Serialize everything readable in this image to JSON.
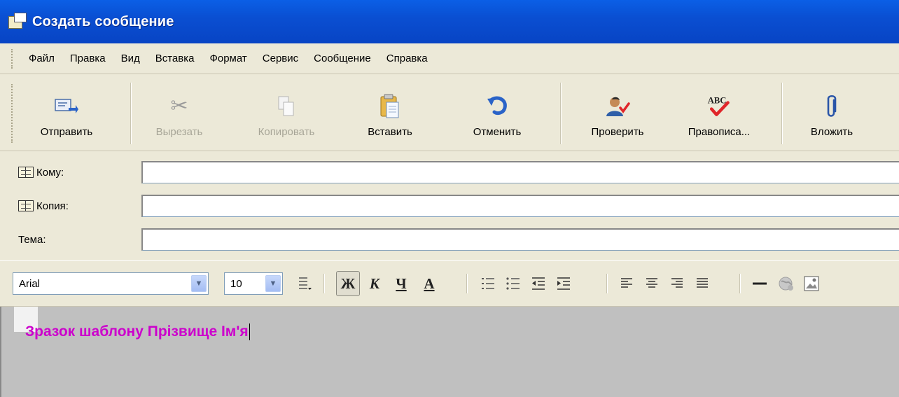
{
  "window": {
    "title": "Создать сообщение",
    "icon": "new-message-icon"
  },
  "menu": [
    "Файл",
    "Правка",
    "Вид",
    "Вставка",
    "Формат",
    "Сервис",
    "Сообщение",
    "Справка"
  ],
  "toolbar": {
    "send": "Отправить",
    "cut": "Вырезать",
    "copy": "Копировать",
    "paste": "Вставить",
    "undo": "Отменить",
    "check": "Проверить",
    "spelling": "Правописа...",
    "attach": "Вложить"
  },
  "headers": {
    "to_label": "Кому:",
    "to_value": "",
    "cc_label": "Копия:",
    "cc_value": "",
    "subject_label": "Тема:",
    "subject_value": ""
  },
  "format": {
    "font": "Arial",
    "size": "10",
    "bold": "Ж",
    "italic": "К",
    "underline": "Ч",
    "font_color": "A"
  },
  "body": {
    "text": "Зразок шаблону Прізвище Ім'я",
    "text_color": "#cc00cc"
  },
  "colors": {
    "titlebar": "#0a4fd2",
    "chrome": "#ece9d8",
    "editor_bg": "#c0c0c0"
  }
}
